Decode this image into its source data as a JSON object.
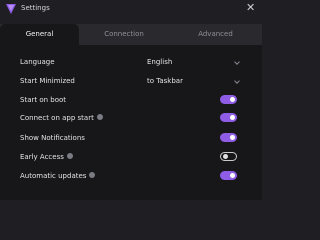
{
  "window": {
    "title": "Settings",
    "close_icon": "close-icon"
  },
  "tabs": [
    {
      "label": "General",
      "active": true
    },
    {
      "label": "Connection",
      "active": false
    },
    {
      "label": "Advanced",
      "active": false
    }
  ],
  "settings": {
    "language": {
      "label": "Language",
      "value": "English"
    },
    "start_minimized": {
      "label": "Start Minimized",
      "value": "to Taskbar"
    },
    "start_on_boot": {
      "label": "Start on boot",
      "enabled": true
    },
    "connect_on_app_start": {
      "label": "Connect on app start",
      "enabled": true,
      "has_info": true
    },
    "show_notifications": {
      "label": "Show Notifications",
      "enabled": true
    },
    "early_access": {
      "label": "Early Access",
      "enabled": false,
      "has_info": true
    },
    "automatic_updates": {
      "label": "Automatic updates",
      "enabled": true,
      "has_info": true
    }
  },
  "colors": {
    "accent": "#8f5ce6",
    "background": "#17171a",
    "tabbar": "#2a2a2e"
  }
}
